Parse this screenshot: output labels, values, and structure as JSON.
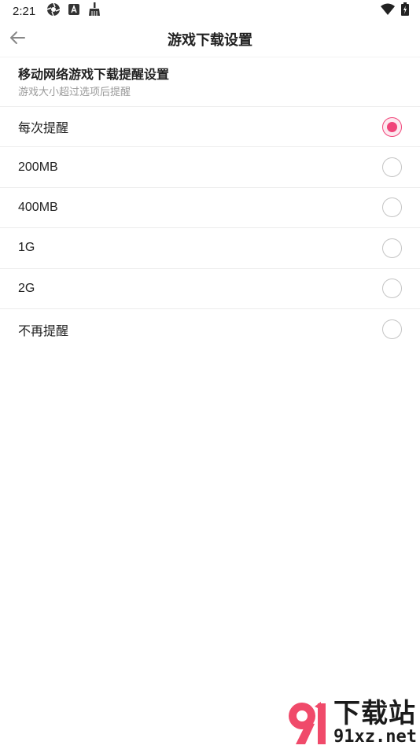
{
  "status_bar": {
    "time": "2:21",
    "left_icons": [
      "aperture-icon",
      "app-a-icon",
      "broom-icon"
    ],
    "right_icons": [
      "wifi-icon",
      "battery-charging-icon"
    ]
  },
  "app_bar": {
    "back_icon": "arrow-left-icon",
    "title": "游戏下载设置"
  },
  "section": {
    "title": "移动网络游戏下载提醒设置",
    "subtitle": "游戏大小超过选项后提醒"
  },
  "options": [
    {
      "label": "每次提醒",
      "selected": true
    },
    {
      "label": "200MB",
      "selected": false
    },
    {
      "label": "400MB",
      "selected": false
    },
    {
      "label": "1G",
      "selected": false
    },
    {
      "label": "2G",
      "selected": false
    },
    {
      "label": "不再提醒",
      "selected": false
    }
  ],
  "colors": {
    "accent": "#f0457a",
    "accent_bg": "#fdeaf0",
    "divider": "#ececec",
    "subtext": "#9a9a9a"
  },
  "watermark": {
    "brand": "下载站",
    "logo_text": "91",
    "url": "91xz.net"
  }
}
